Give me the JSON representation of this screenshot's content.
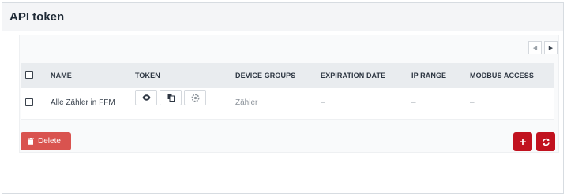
{
  "page": {
    "title": "API token"
  },
  "pager": {
    "prev_icon": "chevron-left-icon",
    "next_icon": "chevron-right-icon"
  },
  "table": {
    "columns": [
      "NAME",
      "TOKEN",
      "DEVICE GROUPS",
      "EXPIRATION DATE",
      "IP RANGE",
      "MODBUS ACCESS"
    ],
    "rows": [
      {
        "name": "Alle Zähler in FFM",
        "token_actions": [
          "eye-icon",
          "copy-icon",
          "settings-icon"
        ],
        "device_groups": "Zähler",
        "expiration_date": "–",
        "ip_range": "–",
        "modbus_access": "–"
      }
    ]
  },
  "actions": {
    "delete_label": "Delete",
    "delete_icon": "trash-icon",
    "add_icon": "plus-icon",
    "refresh_icon": "refresh-icon"
  },
  "colors": {
    "danger": "#d9534f",
    "primary_red": "#c1121f",
    "header_bg": "#e9ecef"
  }
}
